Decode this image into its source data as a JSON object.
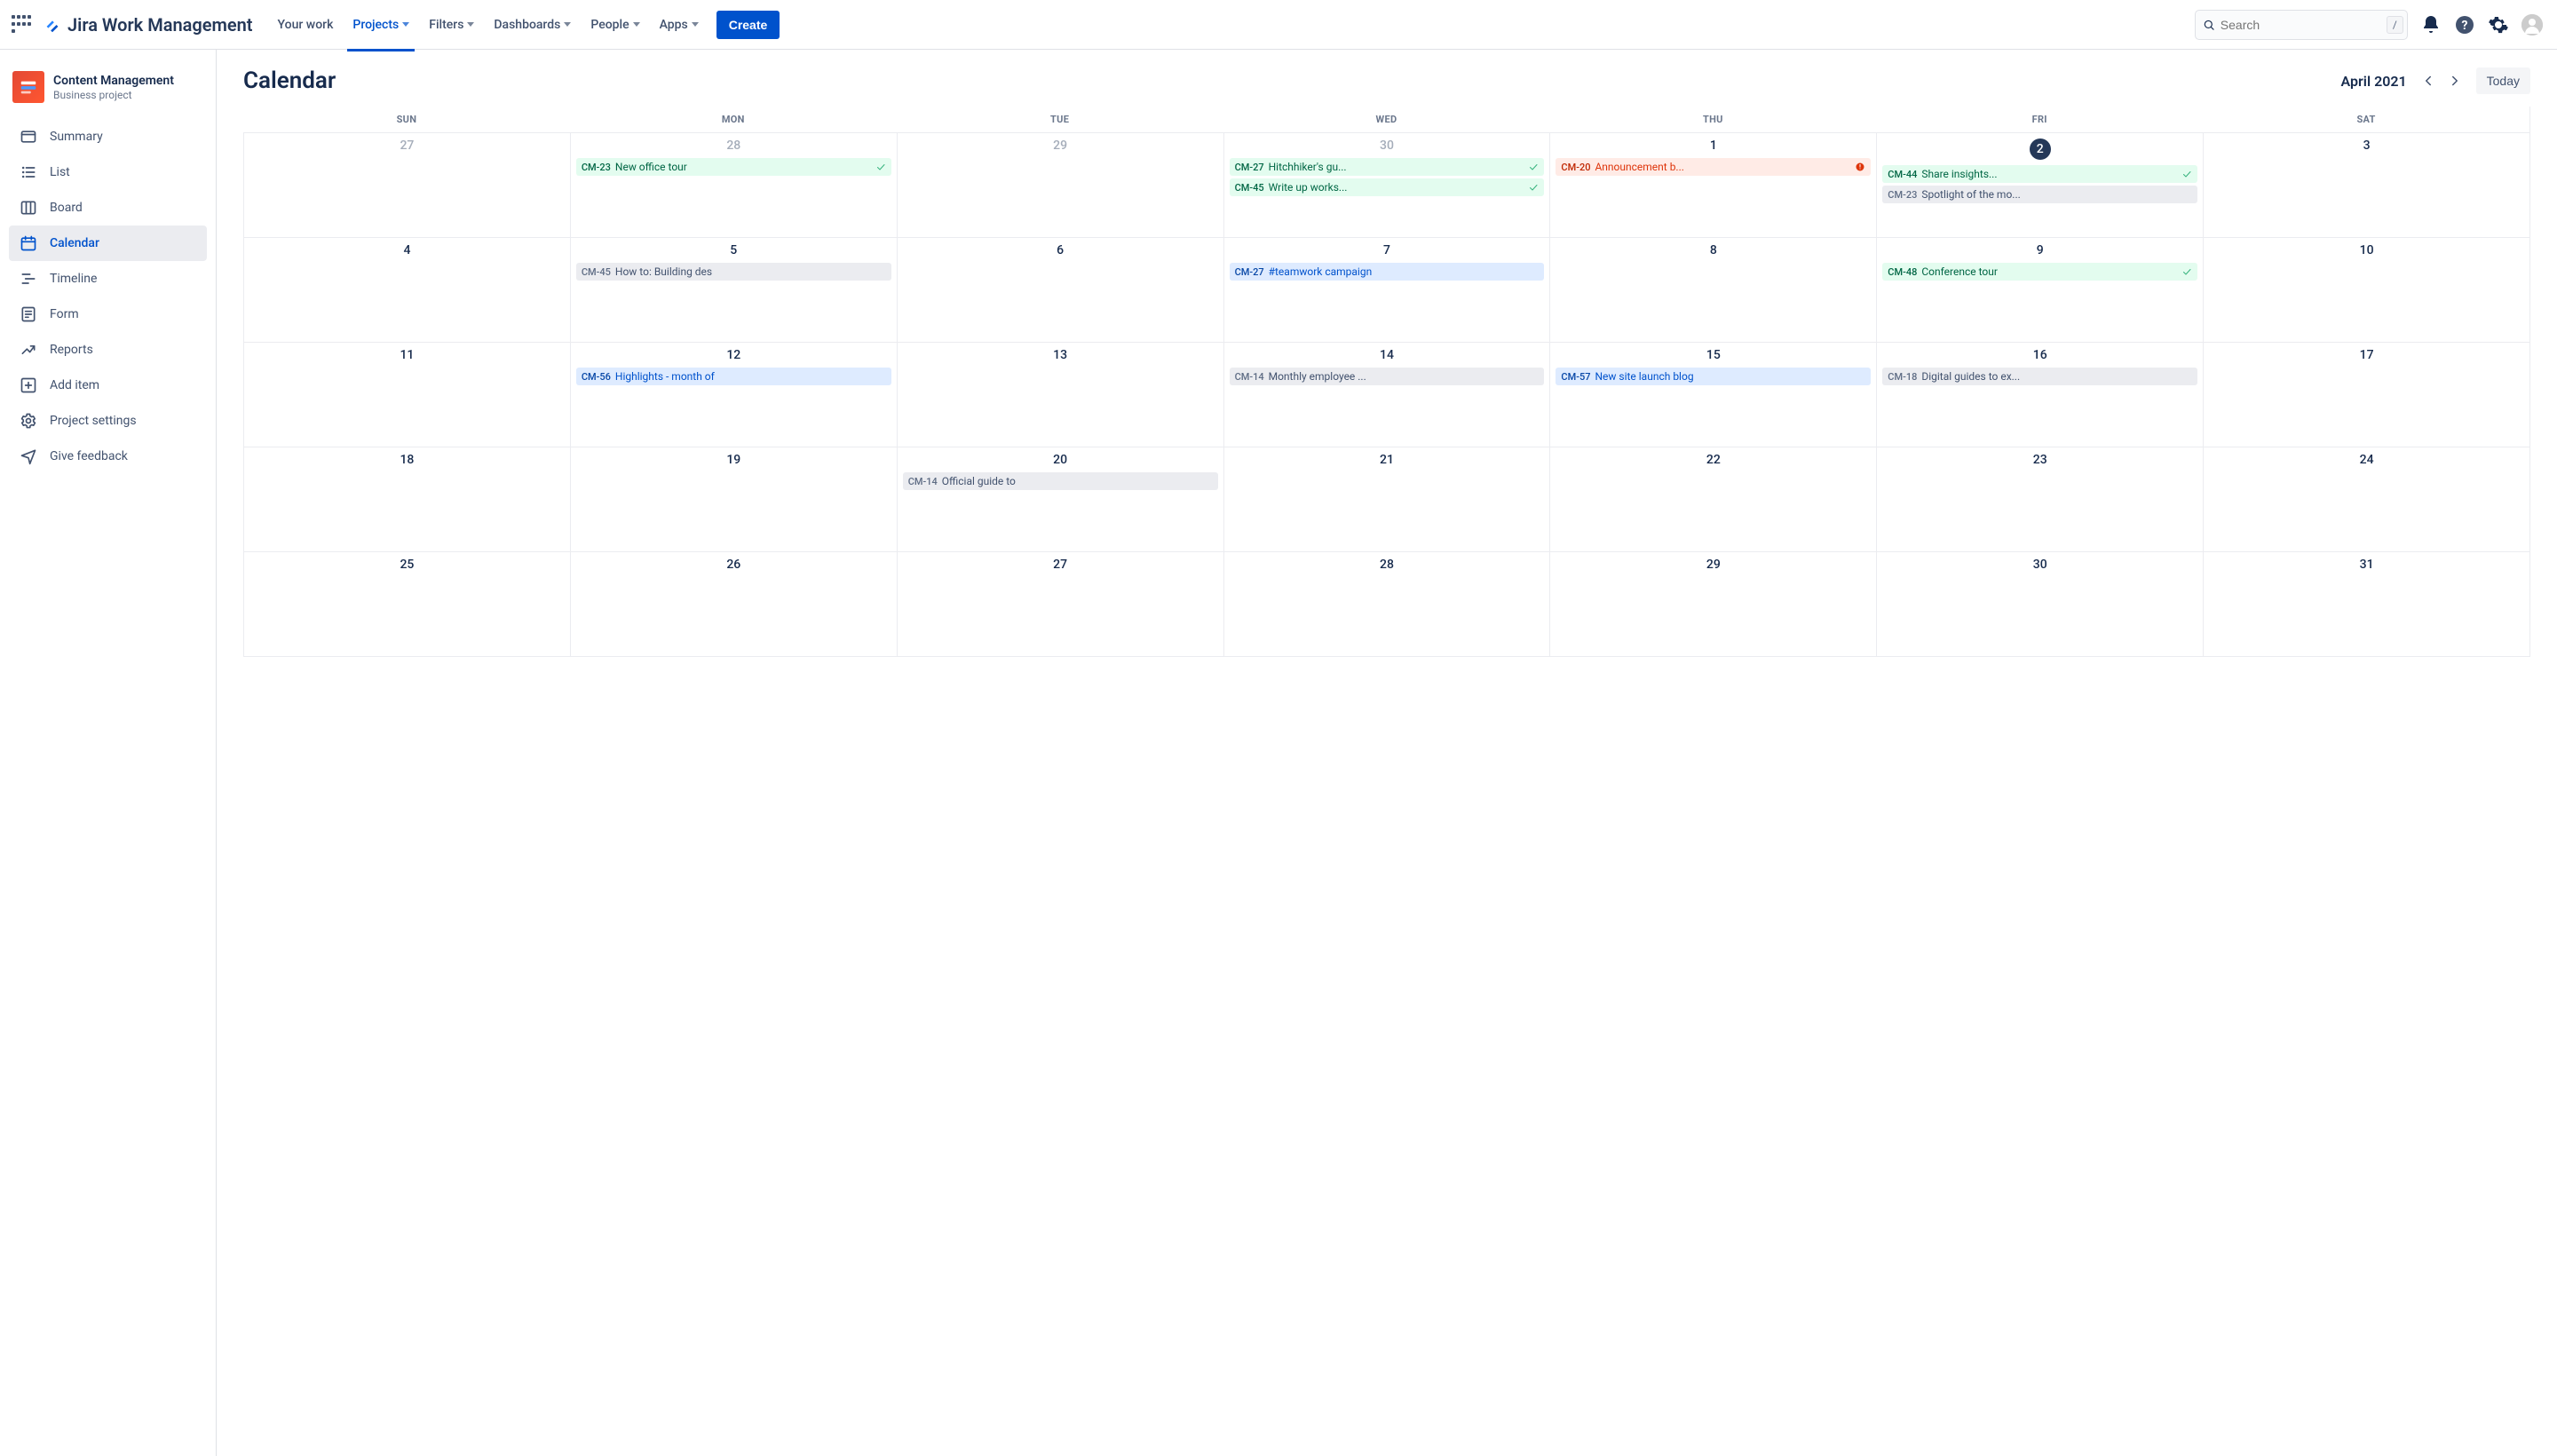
{
  "header": {
    "product_name": "Jira Work Management",
    "nav": [
      {
        "label": "Your work",
        "has_caret": false
      },
      {
        "label": "Projects",
        "has_caret": true
      },
      {
        "label": "Filters",
        "has_caret": true
      },
      {
        "label": "Dashboards",
        "has_caret": true
      },
      {
        "label": "People",
        "has_caret": true
      },
      {
        "label": "Apps",
        "has_caret": true
      }
    ],
    "active_nav_index": 1,
    "create_label": "Create",
    "search_placeholder": "Search",
    "slash_hint": "/"
  },
  "sidebar": {
    "project_name": "Content Management",
    "project_type": "Business project",
    "items": [
      {
        "label": "Summary",
        "icon": "summary"
      },
      {
        "label": "List",
        "icon": "list"
      },
      {
        "label": "Board",
        "icon": "board"
      },
      {
        "label": "Calendar",
        "icon": "calendar"
      },
      {
        "label": "Timeline",
        "icon": "timeline"
      },
      {
        "label": "Form",
        "icon": "form"
      },
      {
        "label": "Reports",
        "icon": "reports"
      },
      {
        "label": "Add item",
        "icon": "add"
      },
      {
        "label": "Project settings",
        "icon": "settings"
      },
      {
        "label": "Give feedback",
        "icon": "feedback"
      }
    ],
    "active_index": 3
  },
  "page": {
    "title": "Calendar",
    "month_label": "April 2021",
    "today_label": "Today"
  },
  "calendar": {
    "day_headers": [
      "SUN",
      "MON",
      "TUE",
      "WED",
      "THU",
      "FRI",
      "SAT"
    ],
    "today_day": 2,
    "weeks": [
      [
        {
          "day": 27,
          "faded": true,
          "events": []
        },
        {
          "day": 28,
          "faded": true,
          "events": [
            {
              "key": "CM-23",
              "title": "New office tour",
              "style": "green-soft",
              "icon": "check"
            }
          ]
        },
        {
          "day": 29,
          "faded": true,
          "events": []
        },
        {
          "day": 30,
          "faded": true,
          "events": [
            {
              "key": "CM-27",
              "title": "Hitchhiker's gu...",
              "style": "green-soft",
              "icon": "check"
            },
            {
              "key": "CM-45",
              "title": "Write up works...",
              "style": "green-soft",
              "icon": "check"
            }
          ]
        },
        {
          "day": 1,
          "events": [
            {
              "key": "CM-20",
              "title": "Announcement b...",
              "style": "red-soft",
              "icon": "bang"
            }
          ]
        },
        {
          "day": 2,
          "events": [
            {
              "key": "CM-44",
              "title": "Share insights...",
              "style": "green-soft",
              "icon": "check"
            },
            {
              "key": "CM-23",
              "title": "Spotlight of the mo...",
              "style": "grey"
            }
          ]
        },
        {
          "day": 3,
          "events": []
        }
      ],
      [
        {
          "day": 4,
          "events": []
        },
        {
          "day": 5,
          "events": [
            {
              "key": "CM-45",
              "title": "How to: Building des",
              "style": "grey"
            }
          ]
        },
        {
          "day": 6,
          "events": []
        },
        {
          "day": 7,
          "events": [
            {
              "key": "CM-27",
              "title": "#teamwork campaign",
              "style": "blue-soft"
            }
          ]
        },
        {
          "day": 8,
          "events": []
        },
        {
          "day": 9,
          "events": [
            {
              "key": "CM-48",
              "title": "Conference tour",
              "style": "green-soft",
              "icon": "check"
            }
          ]
        },
        {
          "day": 10,
          "events": []
        }
      ],
      [
        {
          "day": 11,
          "events": []
        },
        {
          "day": 12,
          "events": [
            {
              "key": "CM-56",
              "title": "Highlights - month of",
              "style": "blue-soft"
            }
          ]
        },
        {
          "day": 13,
          "events": []
        },
        {
          "day": 14,
          "events": [
            {
              "key": "CM-14",
              "title": "Monthly employee ...",
              "style": "grey"
            }
          ]
        },
        {
          "day": 15,
          "events": [
            {
              "key": "CM-57",
              "title": "New site launch blog",
              "style": "blue-soft"
            }
          ]
        },
        {
          "day": 16,
          "events": [
            {
              "key": "CM-18",
              "title": "Digital guides to ex...",
              "style": "grey"
            }
          ]
        },
        {
          "day": 17,
          "events": []
        }
      ],
      [
        {
          "day": 18,
          "events": []
        },
        {
          "day": 19,
          "events": []
        },
        {
          "day": 20,
          "events": [
            {
              "key": "CM-14",
              "title": "Official guide to",
              "style": "grey"
            }
          ]
        },
        {
          "day": 21,
          "events": []
        },
        {
          "day": 22,
          "events": []
        },
        {
          "day": 23,
          "events": []
        },
        {
          "day": 24,
          "events": []
        }
      ],
      [
        {
          "day": 25,
          "events": []
        },
        {
          "day": 26,
          "events": []
        },
        {
          "day": 27,
          "events": []
        },
        {
          "day": 28,
          "events": []
        },
        {
          "day": 29,
          "events": []
        },
        {
          "day": 30,
          "events": []
        },
        {
          "day": 31,
          "events": []
        }
      ]
    ]
  }
}
